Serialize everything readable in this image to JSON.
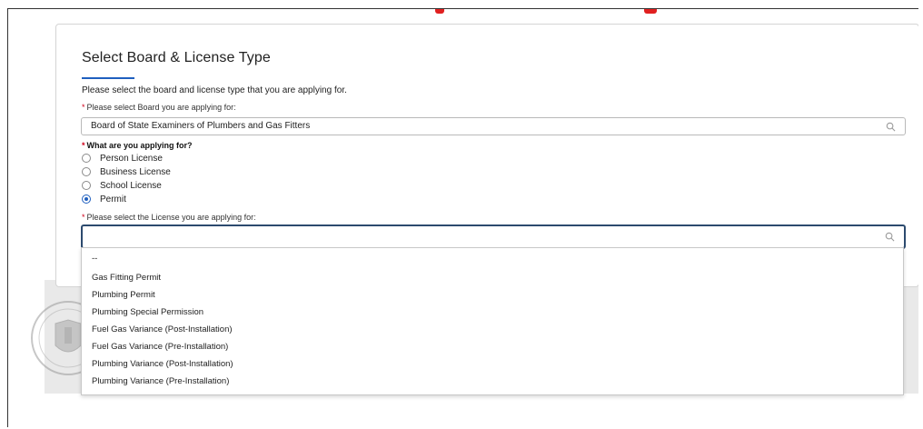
{
  "form": {
    "title": "Select Board & License Type",
    "intro": "Please select the board and license type that you are applying for.",
    "board_label": "Please select Board you are applying for:",
    "board_value": "Board of State Examiners of Plumbers and Gas Fitters",
    "applying_for_label": "What are you applying for?",
    "applying_options": [
      {
        "label": "Person License",
        "selected": false
      },
      {
        "label": "Business License",
        "selected": false
      },
      {
        "label": "School License",
        "selected": false
      },
      {
        "label": "Permit",
        "selected": true
      }
    ],
    "license_label": "Please select the License you are applying for:",
    "license_value": "",
    "required_marker": "*"
  },
  "license_dropdown": {
    "options": [
      "--",
      "Gas Fitting Permit",
      "Plumbing Permit",
      "Plumbing Special Permission",
      "Fuel Gas Variance (Post-Installation)",
      "Fuel Gas Variance (Pre-Installation)",
      "Plumbing Variance (Post-Installation)",
      "Plumbing Variance (Pre-Installation)"
    ]
  },
  "colors": {
    "accent": "#1f5fbf",
    "required": "#d0021b",
    "focus_border": "#2c4a6e",
    "header_decor": "#e02020"
  },
  "icons": {
    "search": "search-icon",
    "seal": "state-seal-icon"
  }
}
